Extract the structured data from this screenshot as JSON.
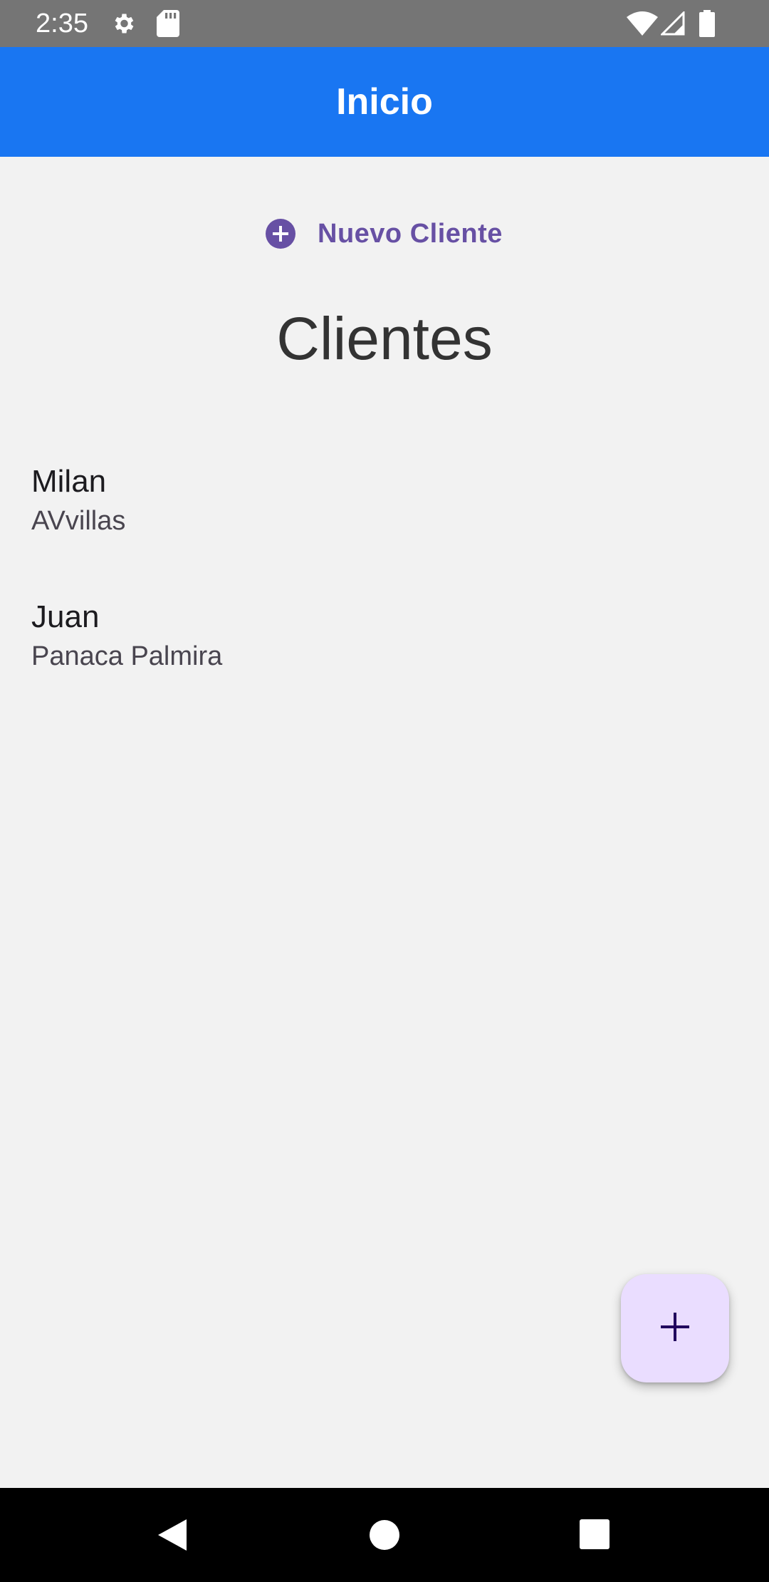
{
  "status_bar": {
    "time": "2:35",
    "icons": [
      "gear-icon",
      "sd-card-icon",
      "wifi-icon",
      "cell-signal-icon",
      "battery-icon"
    ]
  },
  "app_bar": {
    "title": "Inicio",
    "color": "#1976f2"
  },
  "new_client_button": {
    "label": "Nuevo Cliente",
    "icon": "add-circle-icon",
    "color": "#6750a4"
  },
  "section": {
    "title": "Clientes"
  },
  "clients": [
    {
      "name": "Milan",
      "bank": "AVvillas"
    },
    {
      "name": "Juan",
      "bank": "Panaca Palmira"
    }
  ],
  "fab": {
    "icon": "plus-icon",
    "color": "#eaddff"
  },
  "nav_bar": {
    "buttons": [
      "back-icon",
      "home-icon",
      "recents-icon"
    ]
  }
}
